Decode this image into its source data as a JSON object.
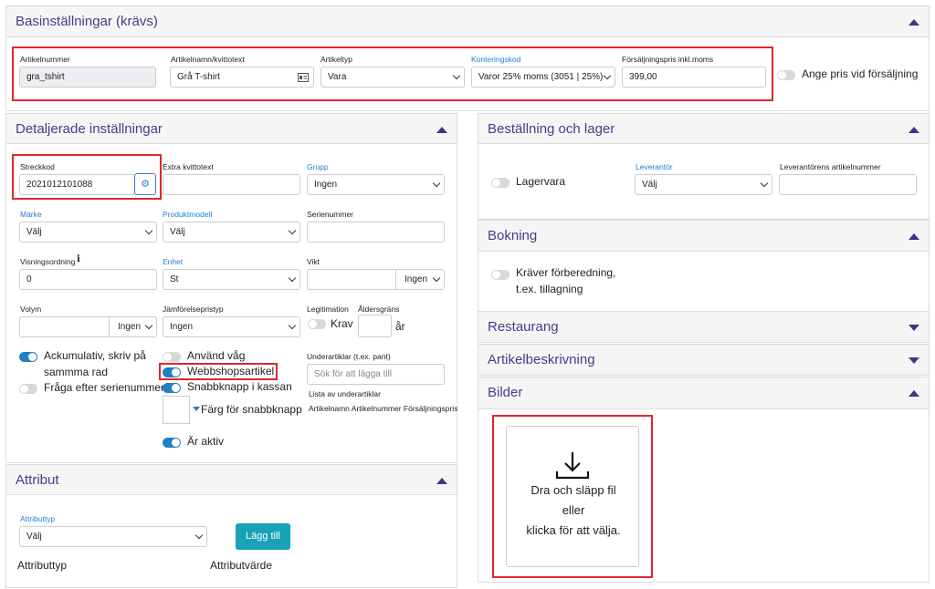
{
  "basic": {
    "title": "Basinställningar (krävs)",
    "artnr_label": "Artikelnummer",
    "artnr_value": "gra_tshirt",
    "name_label": "Artikelnamn/kvittotext",
    "name_value": "Grå T-shirt",
    "type_label": "Artikeltyp",
    "type_value": "Vara",
    "account_label": "Konteringskod",
    "account_value": "Varor 25% moms (3051 | 25%)",
    "price_label": "Försäljningspris inkl.moms",
    "price_value": "399,00",
    "set_price_label": "Ange pris vid försäljning"
  },
  "detail": {
    "title": "Detaljerade inställningar",
    "barcode_label": "Streckkod",
    "barcode_value": "2021012101088",
    "extra_label": "Extra kvittotext",
    "group_label": "Grupp",
    "group_value": "Ingen",
    "brand_label": "Märke",
    "brand_value": "Välj",
    "model_label": "Produktmodell",
    "model_value": "Välj",
    "serial_label": "Serienummer",
    "order_label": "Visningsordning",
    "order_value": "0",
    "unit_label": "Enhet",
    "unit_value": "St",
    "weight_label": "Vikt",
    "weight_unit": "Ingen",
    "volume_label": "Volym",
    "volume_unit": "Ingen",
    "compare_label": "Jämförelsepristyp",
    "compare_value": "Ingen",
    "legit_label": "Legitimation",
    "age_label": "Åldersgräns",
    "require_label": "Krav",
    "years_label": "år",
    "accum_line1": "Ackumulativ, skriv på",
    "accum_line2": "sammma rad",
    "ask_serial": "Fråga efter serienummer",
    "use_scale": "Använd våg",
    "webshop": "Webbshopsartikel",
    "quick": "Snabbknapp i kassan",
    "quick_color": "Färg för snabbknapp",
    "active": "Är aktiv",
    "sub_label": "Underartiklar (t.ex. pant)",
    "sub_placeholder": "Sök för att lägga till",
    "sub_list_label": "Lista av underartiklar",
    "sub_cols": "Artikelnamn Artikelnummer Försäljningspris"
  },
  "attr": {
    "title": "Attribut",
    "type_label": "Attributtyp",
    "type_value": "Välj",
    "add": "Lägg till",
    "col1": "Attributtyp",
    "col2": "Attributvärde"
  },
  "order": {
    "title": "Beställning och lager",
    "stock": "Lagervara",
    "supplier_label": "Leverantör",
    "supplier_value": "Välj",
    "supplier_artnr_label": "Leverantörens artikelnummer"
  },
  "booking": {
    "title": "Bokning",
    "prep_line1": "Kräver förberedning,",
    "prep_line2": "t.ex. tillagning"
  },
  "restaurant": {
    "title": "Restaurang"
  },
  "description": {
    "title": "Artikelbeskrivning"
  },
  "images": {
    "title": "Bilder",
    "drop1": "Dra och släpp fil",
    "drop2": "eller",
    "drop3": "klicka för att välja."
  },
  "icons": [
    "chevron-up-icon",
    "chevron-down-icon",
    "id-card-icon",
    "gears-icon",
    "info-icon",
    "download-icon",
    "caret-down-icon"
  ],
  "colors": {
    "accent": "#4b3a8c",
    "toggle_on": "#1f82c4",
    "button": "#17a2b8",
    "highlight": "#e0262b"
  }
}
